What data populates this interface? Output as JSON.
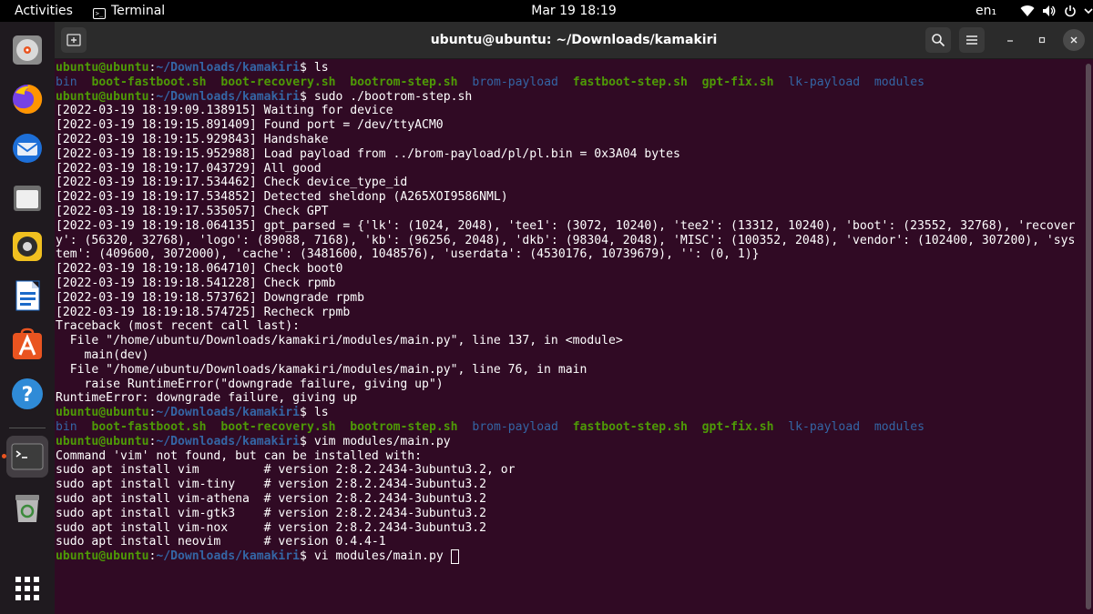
{
  "topbar": {
    "activities": "Activities",
    "app_name": "Terminal",
    "clock": "Mar 19  18:19",
    "input_source": "en₁"
  },
  "dock": {
    "items": [
      {
        "name": "disks-app-icon"
      },
      {
        "name": "firefox-icon"
      },
      {
        "name": "thunderbird-icon"
      },
      {
        "name": "files-icon"
      },
      {
        "name": "rhythmbox-icon"
      },
      {
        "name": "libreoffice-writer-icon"
      },
      {
        "name": "software-center-icon"
      },
      {
        "name": "help-icon"
      },
      {
        "name": "terminal-icon",
        "active": true
      },
      {
        "name": "trash-icon"
      }
    ],
    "show_apps": "show-applications-icon"
  },
  "window": {
    "title": "ubuntu@ubuntu: ~/Downloads/kamakiri"
  },
  "colors": {
    "user": "#4e9a06",
    "path": "#3465a4",
    "dir": "#3465a4",
    "exec": "#4e9a06",
    "terminal_bg": "#300a24",
    "accent": "#e95420"
  },
  "terminal": {
    "lines": [
      [
        [
          "user",
          "ubuntu@ubuntu"
        ],
        [
          "def",
          ":"
        ],
        [
          "path",
          "~/Downloads/kamakiri"
        ],
        [
          "def",
          "$ ls"
        ]
      ],
      [
        [
          "dir",
          "bin"
        ],
        [
          "def",
          "  "
        ],
        [
          "exec",
          "boot-fastboot.sh"
        ],
        [
          "def",
          "  "
        ],
        [
          "exec",
          "boot-recovery.sh"
        ],
        [
          "def",
          "  "
        ],
        [
          "exec",
          "bootrom-step.sh"
        ],
        [
          "def",
          "  "
        ],
        [
          "dir",
          "brom-payload"
        ],
        [
          "def",
          "  "
        ],
        [
          "exec",
          "fastboot-step.sh"
        ],
        [
          "def",
          "  "
        ],
        [
          "exec",
          "gpt-fix.sh"
        ],
        [
          "def",
          "  "
        ],
        [
          "dir",
          "lk-payload"
        ],
        [
          "def",
          "  "
        ],
        [
          "dir",
          "modules"
        ]
      ],
      [
        [
          "user",
          "ubuntu@ubuntu"
        ],
        [
          "def",
          ":"
        ],
        [
          "path",
          "~/Downloads/kamakiri"
        ],
        [
          "def",
          "$ sudo ./bootrom-step.sh"
        ]
      ],
      [
        [
          "def",
          "[2022-03-19 18:19:09.138915] Waiting for device"
        ]
      ],
      [
        [
          "def",
          "[2022-03-19 18:19:15.891409] Found port = /dev/ttyACM0"
        ]
      ],
      [
        [
          "def",
          "[2022-03-19 18:19:15.929843] Handshake"
        ]
      ],
      [
        [
          "def",
          "[2022-03-19 18:19:15.952988] Load payload from ../brom-payload/pl/pl.bin = 0x3A04 bytes"
        ]
      ],
      [
        [
          "def",
          "[2022-03-19 18:19:17.043729] All good"
        ]
      ],
      [
        [
          "def",
          "[2022-03-19 18:19:17.534462] Check device_type_id"
        ]
      ],
      [
        [
          "def",
          "[2022-03-19 18:19:17.534852] Detected sheldonp (A265XOI9586NML)"
        ]
      ],
      [
        [
          "def",
          "[2022-03-19 18:19:17.535057] Check GPT"
        ]
      ],
      [
        [
          "def",
          "[2022-03-19 18:19:18.064135] gpt_parsed = {'lk': (1024, 2048), 'tee1': (3072, 10240), 'tee2': (13312, 10240), 'boot': (23552, 32768), 'recover"
        ]
      ],
      [
        [
          "def",
          "y': (56320, 32768), 'logo': (89088, 7168), 'kb': (96256, 2048), 'dkb': (98304, 2048), 'MISC': (100352, 2048), 'vendor': (102400, 307200), 'sys"
        ]
      ],
      [
        [
          "def",
          "tem': (409600, 3072000), 'cache': (3481600, 1048576), 'userdata': (4530176, 10739679), '': (0, 1)}"
        ]
      ],
      [
        [
          "def",
          "[2022-03-19 18:19:18.064710] Check boot0"
        ]
      ],
      [
        [
          "def",
          "[2022-03-19 18:19:18.541228] Check rpmb"
        ]
      ],
      [
        [
          "def",
          "[2022-03-19 18:19:18.573762] Downgrade rpmb"
        ]
      ],
      [
        [
          "def",
          "[2022-03-19 18:19:18.574725] Recheck rpmb"
        ]
      ],
      [
        [
          "def",
          "Traceback (most recent call last):"
        ]
      ],
      [
        [
          "def",
          "  File \"/home/ubuntu/Downloads/kamakiri/modules/main.py\", line 137, in <module>"
        ]
      ],
      [
        [
          "def",
          "    main(dev)"
        ]
      ],
      [
        [
          "def",
          "  File \"/home/ubuntu/Downloads/kamakiri/modules/main.py\", line 76, in main"
        ]
      ],
      [
        [
          "def",
          "    raise RuntimeError(\"downgrade failure, giving up\")"
        ]
      ],
      [
        [
          "def",
          "RuntimeError: downgrade failure, giving up"
        ]
      ],
      [
        [
          "user",
          "ubuntu@ubuntu"
        ],
        [
          "def",
          ":"
        ],
        [
          "path",
          "~/Downloads/kamakiri"
        ],
        [
          "def",
          "$ ls"
        ]
      ],
      [
        [
          "dir",
          "bin"
        ],
        [
          "def",
          "  "
        ],
        [
          "exec",
          "boot-fastboot.sh"
        ],
        [
          "def",
          "  "
        ],
        [
          "exec",
          "boot-recovery.sh"
        ],
        [
          "def",
          "  "
        ],
        [
          "exec",
          "bootrom-step.sh"
        ],
        [
          "def",
          "  "
        ],
        [
          "dir",
          "brom-payload"
        ],
        [
          "def",
          "  "
        ],
        [
          "exec",
          "fastboot-step.sh"
        ],
        [
          "def",
          "  "
        ],
        [
          "exec",
          "gpt-fix.sh"
        ],
        [
          "def",
          "  "
        ],
        [
          "dir",
          "lk-payload"
        ],
        [
          "def",
          "  "
        ],
        [
          "dir",
          "modules"
        ]
      ],
      [
        [
          "user",
          "ubuntu@ubuntu"
        ],
        [
          "def",
          ":"
        ],
        [
          "path",
          "~/Downloads/kamakiri"
        ],
        [
          "def",
          "$ vim modules/main.py"
        ]
      ],
      [
        [
          "def",
          "Command 'vim' not found, but can be installed with:"
        ]
      ],
      [
        [
          "def",
          "sudo apt install vim         # version 2:8.2.2434-3ubuntu3.2, or"
        ]
      ],
      [
        [
          "def",
          "sudo apt install vim-tiny    # version 2:8.2.2434-3ubuntu3.2"
        ]
      ],
      [
        [
          "def",
          "sudo apt install vim-athena  # version 2:8.2.2434-3ubuntu3.2"
        ]
      ],
      [
        [
          "def",
          "sudo apt install vim-gtk3    # version 2:8.2.2434-3ubuntu3.2"
        ]
      ],
      [
        [
          "def",
          "sudo apt install vim-nox     # version 2:8.2.2434-3ubuntu3.2"
        ]
      ],
      [
        [
          "def",
          "sudo apt install neovim      # version 0.4.4-1"
        ]
      ],
      [
        [
          "user",
          "ubuntu@ubuntu"
        ],
        [
          "def",
          ":"
        ],
        [
          "path",
          "~/Downloads/kamakiri"
        ],
        [
          "def",
          "$ vi modules/main.py "
        ]
      ]
    ]
  }
}
